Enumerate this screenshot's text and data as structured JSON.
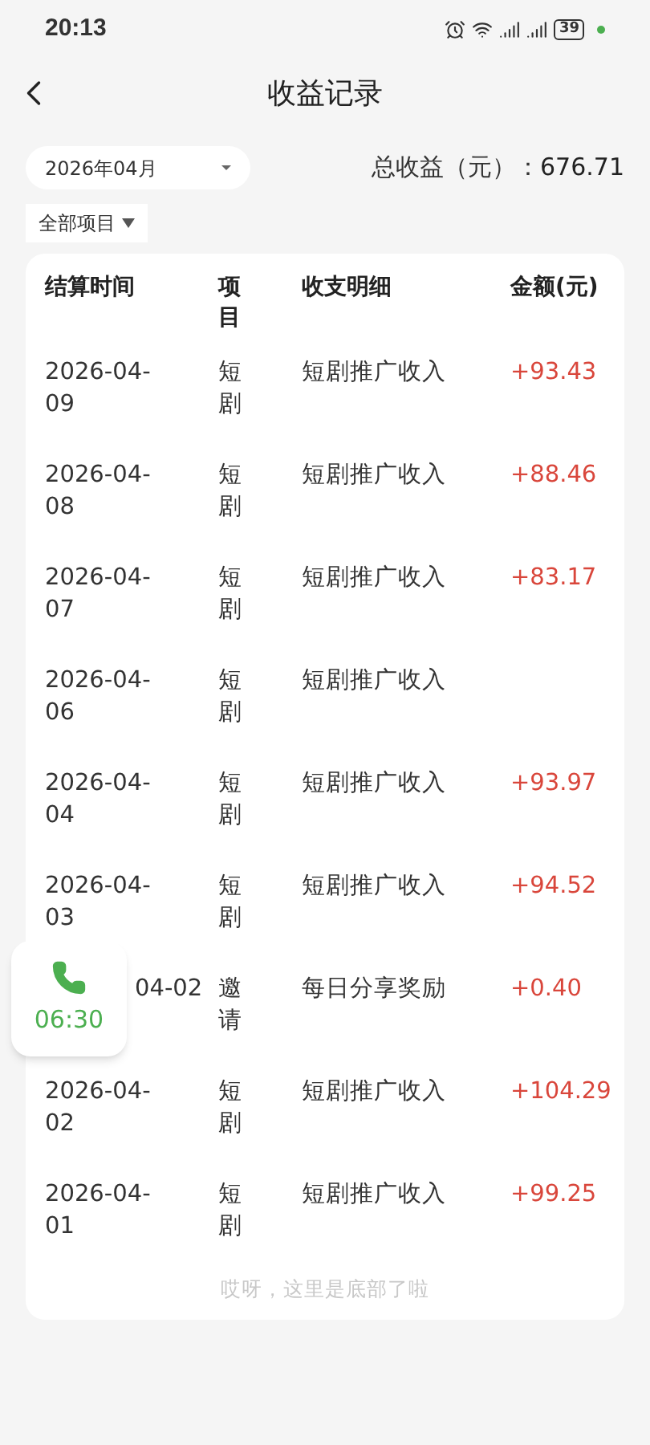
{
  "status_bar": {
    "time": "20:13",
    "battery": "39"
  },
  "header": {
    "title": "收益记录"
  },
  "filters": {
    "month": "2026年04月",
    "project": "全部项目",
    "total_label": "总收益（元）：",
    "total": "676.71"
  },
  "table": {
    "columns": [
      "结算时间",
      "项目",
      "收支明细",
      "金额(元)"
    ],
    "rows": [
      {
        "date": "2026-04-09",
        "item": "短剧",
        "detail": "短剧推广收入",
        "amount": "+93.43"
      },
      {
        "date": "2026-04-08",
        "item": "短剧",
        "detail": "短剧推广收入",
        "amount": "+88.46"
      },
      {
        "date": "2026-04-07",
        "item": "短剧",
        "detail": "短剧推广收入",
        "amount": "+83.17"
      },
      {
        "date": "2026-04-06",
        "item": "短剧",
        "detail": "短剧推广收入"
      },
      {
        "date": "2026-04-04",
        "item": "短剧",
        "detail": "短剧推广收入",
        "amount": "+93.97"
      },
      {
        "date": "2026-04-03",
        "item": "短剧",
        "detail": "短剧推广收入",
        "amount": "+94.52"
      },
      {
        "date": "04-02",
        "partly_covered": true,
        "item": "邀请",
        "detail": "每日分享奖励",
        "amount": "+0.40"
      },
      {
        "date": "2026-04-02",
        "item": "短剧",
        "detail": "短剧推广收入",
        "amount": "+104.29"
      },
      {
        "date": "2026-04-01",
        "item": "短剧",
        "detail": "短剧推广收入",
        "amount": "+99.25"
      }
    ],
    "footer": "哎呀，这里是底部了啦"
  },
  "call_bubble": {
    "time": "06:30"
  }
}
